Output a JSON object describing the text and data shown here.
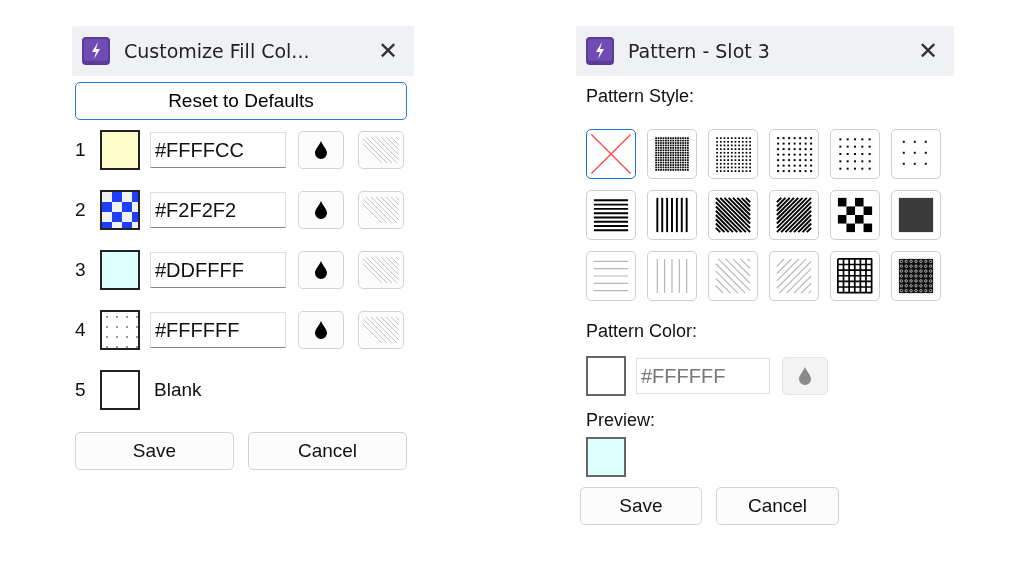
{
  "fill_dialog": {
    "title": "Customize Fill Col...",
    "close": "✕",
    "reset_button": "Reset to Defaults",
    "slots": [
      {
        "number": "1",
        "kind": "solid",
        "color": "#ffffcc",
        "value": "#FFFFCC"
      },
      {
        "number": "2",
        "kind": "checker",
        "color": "#f2f2f2",
        "value": "#F2F2F2"
      },
      {
        "number": "3",
        "kind": "solid",
        "color": "#ddffff",
        "value": "#DDFFFF"
      },
      {
        "number": "4",
        "kind": "dots",
        "color": "#ffffff",
        "value": "#FFFFFF"
      },
      {
        "number": "5",
        "kind": "blank",
        "color": "#ffffff",
        "label": "Blank"
      }
    ],
    "buttons": [
      "Save",
      "Cancel"
    ]
  },
  "pattern_dialog": {
    "title": "Pattern - Slot 3",
    "close": "✕",
    "style_label": "Pattern Style:",
    "patterns": [
      {
        "kind": "none",
        "light": false,
        "selected": true
      },
      {
        "kind": "mesh",
        "light": false,
        "selected": false
      },
      {
        "kind": "dotsfine",
        "light": false,
        "selected": false
      },
      {
        "kind": "dotssmall",
        "light": false,
        "selected": false
      },
      {
        "kind": "dotsmedium",
        "light": false,
        "selected": false
      },
      {
        "kind": "dotswide",
        "light": false,
        "selected": false
      },
      {
        "kind": "horizontal",
        "light": false,
        "selected": false
      },
      {
        "kind": "vertical",
        "light": false,
        "selected": false
      },
      {
        "kind": "backslash",
        "light": false,
        "selected": false
      },
      {
        "kind": "slash",
        "light": false,
        "selected": false
      },
      {
        "kind": "checker",
        "light": false,
        "selected": false
      },
      {
        "kind": "dense",
        "light": false,
        "selected": false
      },
      {
        "kind": "horizontal",
        "light": true,
        "selected": false
      },
      {
        "kind": "vertical",
        "light": true,
        "selected": false
      },
      {
        "kind": "backslash",
        "light": true,
        "selected": false
      },
      {
        "kind": "slash",
        "light": true,
        "selected": false
      },
      {
        "kind": "grid",
        "light": false,
        "selected": false
      },
      {
        "kind": "diamonds",
        "light": false,
        "selected": false
      }
    ],
    "color_label": "Pattern Color:",
    "pattern_color": {
      "color": "#ffffff",
      "value": "#FFFFFF",
      "disabled": true
    },
    "preview_label": "Preview:",
    "preview": {
      "color": "#ddffff"
    },
    "buttons": [
      "Save",
      "Cancel"
    ]
  }
}
